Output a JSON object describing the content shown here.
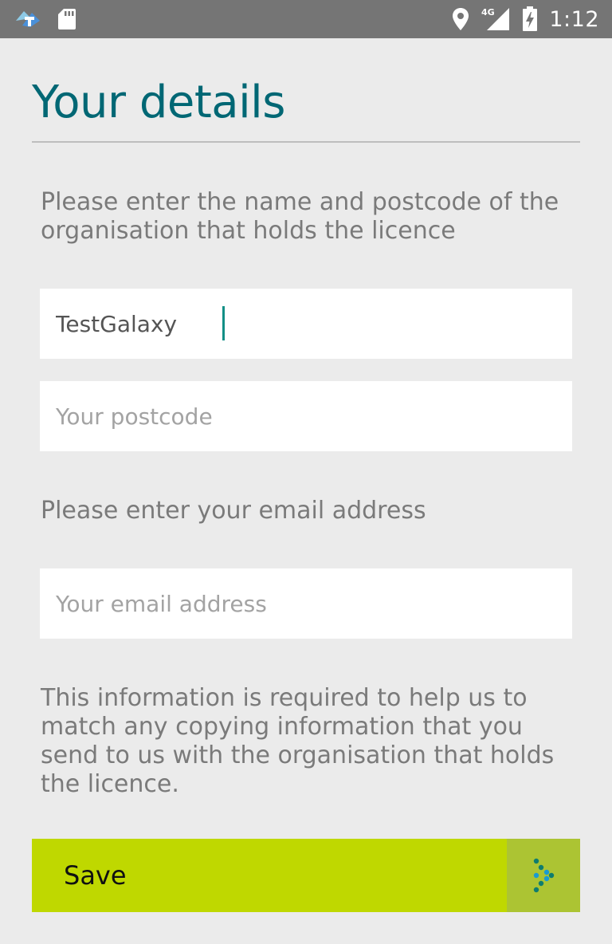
{
  "status_bar": {
    "time": "1:12",
    "network": "4G",
    "icons": [
      "app-notification-icon",
      "sd-card-icon",
      "location-icon",
      "signal-icon",
      "battery-charging-icon"
    ]
  },
  "header": {
    "title": "Your details"
  },
  "form": {
    "intro_text": "Please enter the name and postcode of the organisation that holds the licence",
    "organisation_name": {
      "value": "TestGalaxy",
      "placeholder": ""
    },
    "postcode": {
      "value": "",
      "placeholder": "Your postcode"
    },
    "email_prompt": "Please enter your email address",
    "email": {
      "value": "",
      "placeholder": "Your email address"
    },
    "info_text": "This information is required to help us to match any copying information that you send to us with the organisation that holds the licence."
  },
  "actions": {
    "save_label": "Save"
  },
  "colors": {
    "status_bar": "#757575",
    "background": "#ebebeb",
    "title": "#006774",
    "save_button": "#bfd800",
    "save_arrow_bg": "#acc433",
    "caret": "#128f86"
  }
}
